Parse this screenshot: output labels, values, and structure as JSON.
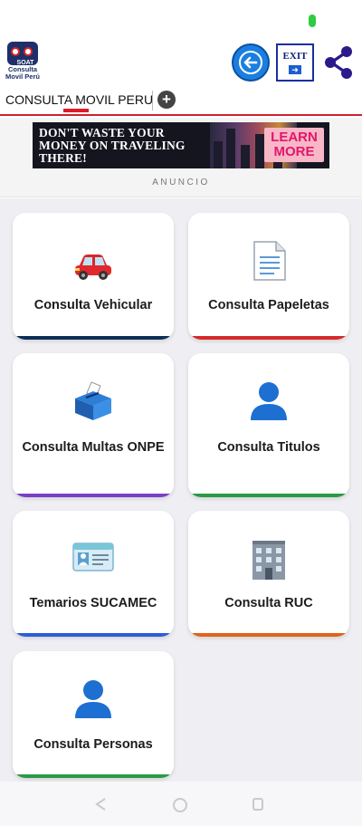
{
  "app": {
    "logo_soat": "SOAT",
    "logo_text_line1": "Consulta",
    "logo_text_line2": "Movil Perú",
    "exit_label": "EXIT"
  },
  "tabs": {
    "active_label": "CONSULTA MOVIL PERU",
    "add_label": "+"
  },
  "ad": {
    "headline": "DON'T WASTE YOUR MONEY ON TRAVELING THERE!",
    "cta": "LEARN MORE",
    "label": "ANUNCIO"
  },
  "cards": [
    {
      "title": "Consulta Vehicular",
      "icon": "car-icon",
      "accent": "#0d2f57"
    },
    {
      "title": "Consulta Papeletas",
      "icon": "document-icon",
      "accent": "#d72a2a"
    },
    {
      "title": "Consulta Multas ONPE",
      "icon": "ballot-box-icon",
      "accent": "#7b3fc6"
    },
    {
      "title": "Consulta Titulos",
      "icon": "person-icon",
      "accent": "#2a9a45"
    },
    {
      "title": "Temarios SUCAMEC",
      "icon": "id-card-icon",
      "accent": "#2b5fd6"
    },
    {
      "title": "Consulta RUC",
      "icon": "building-icon",
      "accent": "#e2621a"
    },
    {
      "title": "Consulta Personas",
      "icon": "person-icon",
      "accent": "#2a9a45"
    }
  ],
  "colors": {
    "accent_red": "#d0212b",
    "back_button": "#1a7fe0",
    "share_icon": "#2a1a8a"
  }
}
